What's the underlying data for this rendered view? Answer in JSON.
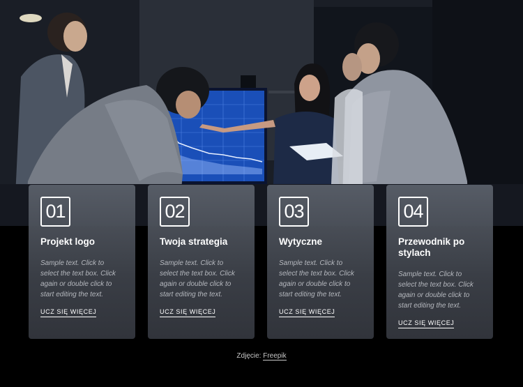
{
  "cards": [
    {
      "number": "01",
      "title": "Projekt logo",
      "text": "Sample text. Click to select the text box. Click again or double click to start editing the text.",
      "link": "UCZ SIĘ WIĘCEJ"
    },
    {
      "number": "02",
      "title": "Twoja strategia",
      "text": "Sample text. Click to select the text box. Click again or double click to start editing the text.",
      "link": "UCZ SIĘ WIĘCEJ"
    },
    {
      "number": "03",
      "title": "Wytyczne",
      "text": "Sample text. Click to select the text box. Click again or double click to start editing the text.",
      "link": "UCZ SIĘ WIĘCEJ"
    },
    {
      "number": "04",
      "title": "Przewodnik po stylach",
      "text": "Sample text. Click to select the text box. Click again or double click to start editing the text.",
      "link": "UCZ SIĘ WIĘCEJ"
    }
  ],
  "credit": {
    "prefix": "Zdjęcie:",
    "link": "Freepik"
  },
  "colors": {
    "card_bg": "#4a4e57",
    "page_bg": "#000000",
    "accent": "#ffffff"
  }
}
